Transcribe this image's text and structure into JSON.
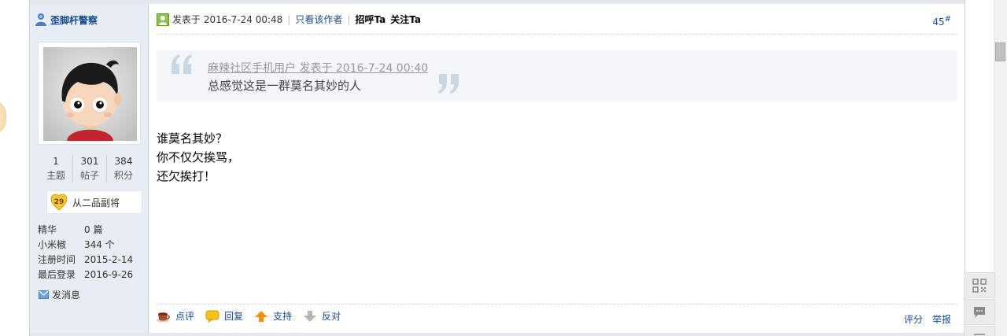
{
  "author": {
    "name": "歪脚杆警察",
    "icon": "user-online-icon",
    "stats": [
      {
        "value": "1",
        "label": "主题"
      },
      {
        "value": "301",
        "label": "帖子"
      },
      {
        "value": "384",
        "label": "积分"
      }
    ],
    "medal": {
      "level": "29",
      "text": "从二品副将"
    },
    "info": [
      {
        "key": "精华",
        "value": "0 篇"
      },
      {
        "key": "小米椒",
        "value": "344 个"
      },
      {
        "key": "注册时间",
        "value": "2015-2-14"
      },
      {
        "key": "最后登录",
        "value": "2016-9-26"
      }
    ],
    "send_message": "发消息"
  },
  "post": {
    "posted_at": "发表于 2016-7-24 00:48",
    "only_author": "只看该作者",
    "greet": "招呼Ta",
    "follow": "关注Ta",
    "floor": "45",
    "floor_suffix": "#",
    "quote": {
      "source": "麻辣社区手机用户 发表于 2016-7-24 00:40",
      "text": "总感觉这是一群莫名其妙的人"
    },
    "body": [
      "谁莫名其妙？",
      "你不仅欠挨骂，",
      "还欠挨打！"
    ],
    "actions": {
      "comment": "点评",
      "reply": "回复",
      "support": "支持",
      "oppose": "反对",
      "rate": "评分",
      "report": "举报"
    }
  },
  "colors": {
    "link": "#1a4b8c",
    "sidebar_bg": "#e7edf3",
    "quote_bg": "#f3f5f8"
  }
}
